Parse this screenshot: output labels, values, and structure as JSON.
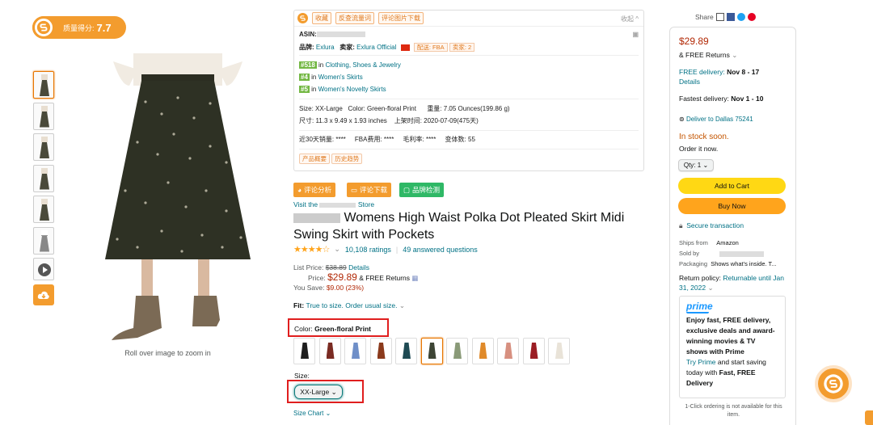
{
  "colors": {
    "accent": "#f39c2e",
    "link": "#007185",
    "price": "#b12704",
    "star": "#ffa41c",
    "add_to_cart": "#ffd814",
    "buy_now": "#ffa41c",
    "highlight_box": "#e01e1e",
    "instock": "#c45500"
  },
  "badge": {
    "label": "质量得分:",
    "score": "7.7"
  },
  "gallery": {
    "caption": "Roll over image to zoom in",
    "thumbs": [
      "image-1",
      "image-2",
      "image-3",
      "image-4",
      "image-5",
      "image-6",
      "video",
      "download"
    ]
  },
  "plugin": {
    "tags": [
      "收藏",
      "反查流量词",
      "评论图片下载"
    ],
    "collapse": "收起 ^",
    "asin_label": "ASIN:",
    "brand_label": "品牌:",
    "brand_value": "Exlura",
    "seller_label": "卖家:",
    "seller_value": "Exlura Official",
    "delivery_tag": "配送: FBA",
    "sellers_tag": "卖家: 2",
    "ranks": [
      {
        "rank": "#518",
        "text": "in",
        "cat": "Clothing, Shoes & Jewelry"
      },
      {
        "rank": "#4",
        "text": "in",
        "cat": "Women's Skirts"
      },
      {
        "rank": "#5",
        "text": "in",
        "cat": "Women's Novelty Skirts"
      }
    ],
    "size_line": "Size: XX-Large",
    "color_line": "Color: Green-floral Print",
    "weight_line": "重量: 7.05 Ounces(199.86 g)",
    "dims_line": "尺寸: 11.3 x 9.49 x 1.93 inches",
    "date_line": "上架时间: 2020-07-09(475天)",
    "sales_line": "近30天销量: ****",
    "fba_line": "FBA费用: ****",
    "margin_line": "毛利率: ****",
    "variants_line": "变体数: 55",
    "bottom_tags": [
      "产品概要",
      "历史趋势"
    ]
  },
  "actions": {
    "review_analysis": "评论分析",
    "review_download": "评论下载",
    "brand_check": "品牌检测"
  },
  "product": {
    "visit_prefix": "Visit the",
    "visit_suffix": "Store",
    "title": "Womens High Waist Polka Dot Pleated Skirt Midi Swing Skirt with Pockets",
    "rating_stars": "★★★★☆",
    "rating_chevron": "⌄",
    "rating_value": 4.3,
    "ratings_count": "10,108 ratings",
    "separator": "|",
    "answered": "49 answered questions",
    "list_price_label": "List Price:",
    "list_price": "$38.89",
    "details": "Details",
    "price_label": "Price:",
    "price": "$29.89",
    "free_returns": "& FREE Returns",
    "save_label": "You Save:",
    "save_value": "$9.00 (23%)",
    "fit_label": "Fit:",
    "fit_value": "True to size. Order usual size.",
    "color_label": "Color:",
    "color_value": "Green-floral Print",
    "swatch_colors": [
      "#1d1d1d",
      "#7a2b22",
      "#6f8fc8",
      "#8b3a1c",
      "#1e4a53",
      "#3d4535",
      "#8a9a78",
      "#e08a2a",
      "#d79080",
      "#9b1d24",
      "#e9e3d8"
    ],
    "size_label": "Size:",
    "size_value": "XX-Large",
    "size_chart": "Size Chart"
  },
  "share": {
    "label": "Share"
  },
  "buybox": {
    "price": "$29.89",
    "free_returns": "& FREE Returns",
    "free_delivery_label": "FREE delivery:",
    "free_delivery_date": "Nov 8 - 17",
    "details": "Details",
    "fastest_label": "Fastest delivery:",
    "fastest_date": "Nov 1 - 10",
    "deliver_to": "Deliver to Dallas 75241",
    "stock": "In stock soon.",
    "order_now": "Order it now.",
    "qty": "Qty: 1",
    "add_to_cart": "Add to Cart",
    "buy_now": "Buy Now",
    "secure": "Secure transaction",
    "ships_from_label": "Ships from",
    "ships_from": "Amazon",
    "sold_by_label": "Sold by",
    "packaging_label": "Packaging",
    "packaging": "Shows what's inside. T...",
    "return_policy_label": "Return policy:",
    "return_policy": "Returnable until Jan 31, 2022",
    "prime_logo": "prime",
    "prime_bold": "Enjoy fast, FREE delivery, exclusive deals and award-winning movies & TV shows with Prime",
    "prime_try": "Try Prime",
    "prime_rest": "and start saving today with",
    "prime_fast": "Fast, FREE Delivery",
    "one_click": "1-Click ordering is not available for this item."
  }
}
